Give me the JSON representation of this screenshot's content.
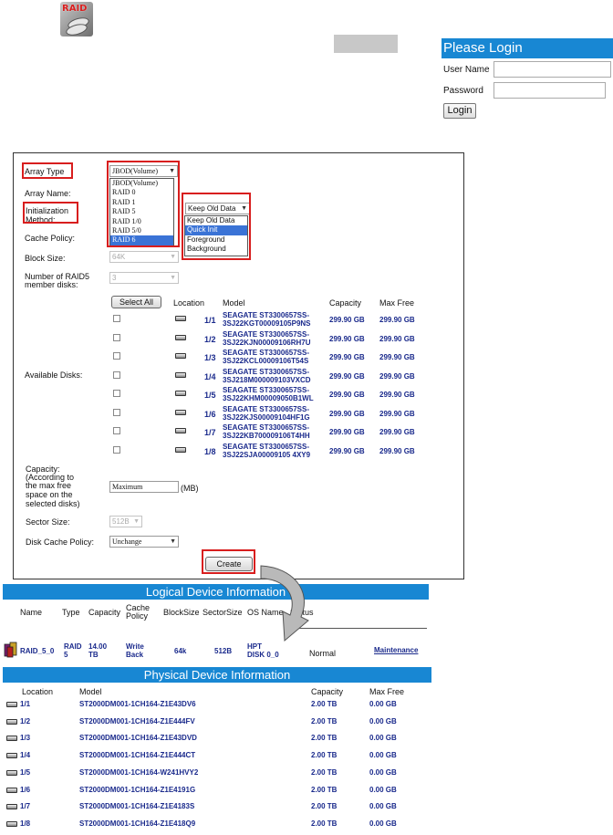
{
  "logo": {
    "text": "RAID"
  },
  "login": {
    "title": "Please Login",
    "username_label": "User Name",
    "password_label": "Password",
    "username_value": "",
    "password_value": "",
    "button": "Login"
  },
  "create": {
    "array_type_label": "Array Type",
    "array_type_value": "JBOD(Volume)",
    "array_type_options": [
      "JBOD(Volume)",
      "RAID 0",
      "RAID 1",
      "RAID 5",
      "RAID 1/0",
      "RAID 5/0",
      "RAID 6"
    ],
    "array_type_highlight": "RAID 6",
    "array_name_label": "Array Name:",
    "init_label_1": "Initialization",
    "init_label_2": "Method:",
    "init_value": "Keep Old Data",
    "init_options": [
      "Keep Old Data",
      "Quick Init",
      "Foreground",
      "Background"
    ],
    "init_highlight": "Quick Init",
    "cache_policy_label": "Cache Policy:",
    "block_size_label": "Block Size:",
    "block_size_value": "64K",
    "raid5_label_1": "Number of RAID5",
    "raid5_label_2": "member disks:",
    "raid5_value": "3",
    "select_all": "Select All",
    "headers": {
      "location": "Location",
      "model": "Model",
      "capacity": "Capacity",
      "max_free": "Max Free"
    },
    "available_disks_label": "Available Disks:",
    "disks": [
      {
        "loc": "1/1",
        "model1": "SEAGATE ST3300657SS-",
        "model2": "3SJ22KGT00009105P9NS",
        "cap": "299.90 GB",
        "free": "299.90 GB"
      },
      {
        "loc": "1/2",
        "model1": "SEAGATE ST3300657SS-",
        "model2": "3SJ22KJN00009106RH7U",
        "cap": "299.90 GB",
        "free": "299.90 GB"
      },
      {
        "loc": "1/3",
        "model1": "SEAGATE ST3300657SS-",
        "model2": "3SJ22KCL00009106T54S",
        "cap": "299.90 GB",
        "free": "299.90 GB"
      },
      {
        "loc": "1/4",
        "model1": "SEAGATE ST3300657SS-",
        "model2": "3SJ218M000009103VXCD",
        "cap": "299.90 GB",
        "free": "299.90 GB"
      },
      {
        "loc": "1/5",
        "model1": "SEAGATE ST3300657SS-",
        "model2": "3SJ22KHM00009050B1WL",
        "cap": "299.90 GB",
        "free": "299.90 GB"
      },
      {
        "loc": "1/6",
        "model1": "SEAGATE ST3300657SS-",
        "model2": "3SJ22KJS00009104HF1G",
        "cap": "299.90 GB",
        "free": "299.90 GB"
      },
      {
        "loc": "1/7",
        "model1": "SEAGATE ST3300657SS-",
        "model2": "3SJ22KB700009106T4HH",
        "cap": "299.90 GB",
        "free": "299.90 GB"
      },
      {
        "loc": "1/8",
        "model1": "SEAGATE ST3300657SS-",
        "model2": "3SJ22SJA00009105 4XY9",
        "cap": "299.90 GB",
        "free": "299.90 GB"
      }
    ],
    "capacity_label": [
      "Capacity:",
      "(According to",
      "the max free",
      "space on the",
      "selected disks)"
    ],
    "capacity_value": "Maximum",
    "capacity_unit": "(MB)",
    "sector_size_label": "Sector Size:",
    "sector_size_value": "512B",
    "disk_cache_label": "Disk Cache Policy:",
    "disk_cache_value": "Unchange",
    "create_button": "Create"
  },
  "logical": {
    "title": "Logical Device Information",
    "headers": {
      "name": "Name",
      "type": "Type",
      "capacity": "Capacity",
      "cache1": "Cache",
      "cache2": "Policy",
      "blocksize": "BlockSize",
      "sectorsize": "SectorSize",
      "osname": "OS Name",
      "status": "Status"
    },
    "row": {
      "name": "RAID_5_0",
      "type1": "RAID",
      "type2": "5",
      "cap1": "14.00",
      "cap2": "TB",
      "cache1": "Write",
      "cache2": "Back",
      "block": "64k",
      "sector": "512B",
      "os1": "HPT",
      "os2": "DISK 0_0",
      "status": "Normal",
      "action": "Maintenance"
    }
  },
  "physical": {
    "title": "Physical Device Information",
    "headers": {
      "location": "Location",
      "model": "Model",
      "capacity": "Capacity",
      "max_free": "Max Free"
    },
    "rows": [
      {
        "loc": "1/1",
        "model": "ST2000DM001-1CH164-Z1E43DV6",
        "cap": "2.00 TB",
        "free": "0.00 GB"
      },
      {
        "loc": "1/2",
        "model": "ST2000DM001-1CH164-Z1E444FV",
        "cap": "2.00 TB",
        "free": "0.00 GB"
      },
      {
        "loc": "1/3",
        "model": "ST2000DM001-1CH164-Z1E43DVD",
        "cap": "2.00 TB",
        "free": "0.00 GB"
      },
      {
        "loc": "1/4",
        "model": "ST2000DM001-1CH164-Z1E444CT",
        "cap": "2.00 TB",
        "free": "0.00 GB"
      },
      {
        "loc": "1/5",
        "model": "ST2000DM001-1CH164-W241HVY2",
        "cap": "2.00 TB",
        "free": "0.00 GB"
      },
      {
        "loc": "1/6",
        "model": "ST2000DM001-1CH164-Z1E4191G",
        "cap": "2.00 TB",
        "free": "0.00 GB"
      },
      {
        "loc": "1/7",
        "model": "ST2000DM001-1CH164-Z1E4183S",
        "cap": "2.00 TB",
        "free": "0.00 GB"
      },
      {
        "loc": "1/8",
        "model": "ST2000DM001-1CH164-Z1E418Q9",
        "cap": "2.00 TB",
        "free": "0.00 GB"
      }
    ]
  },
  "colors": {
    "header_blue": "#1887d3",
    "highlight_red": "#d81e1e",
    "text_blue": "#1a2a8c"
  }
}
